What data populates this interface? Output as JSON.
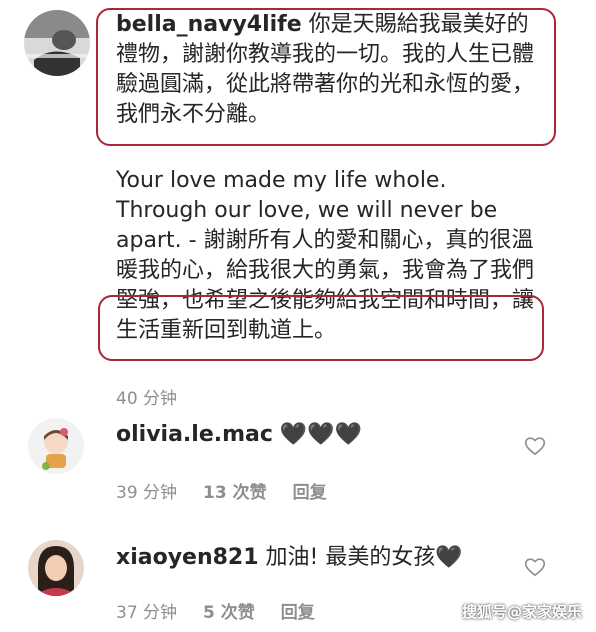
{
  "comments": [
    {
      "username": "bella_navy4life",
      "text": "你是天賜給我最美好的禮物，謝謝你教導我的一切。我的人生已體驗過圓滿，從此將帶著你的光和永恆的愛，我們永不分離。",
      "text_en": "Your love made my life whole. Through our love, we will never be apart. - 謝謝所有人的愛和關心，真的很溫暖我的心，給我很大的勇氣，我會為了我們堅強，也希望之後能夠給我空間和時間，讓生活重新回到軌道上。",
      "time": "40 分钟"
    },
    {
      "username": "olivia.le.mac",
      "text": "🖤🖤🖤",
      "time": "39 分钟",
      "likes": "13 次赞",
      "reply": "回复"
    },
    {
      "username": "xiaoyen821",
      "text": "加油! 最美的女孩🖤",
      "time": "37 分钟",
      "likes": "5 次赞",
      "reply": "回复"
    }
  ],
  "watermark": "搜狐号@家家娱乐",
  "colors": {
    "highlight": "#a8283a",
    "meta": "#8e8e8e"
  }
}
